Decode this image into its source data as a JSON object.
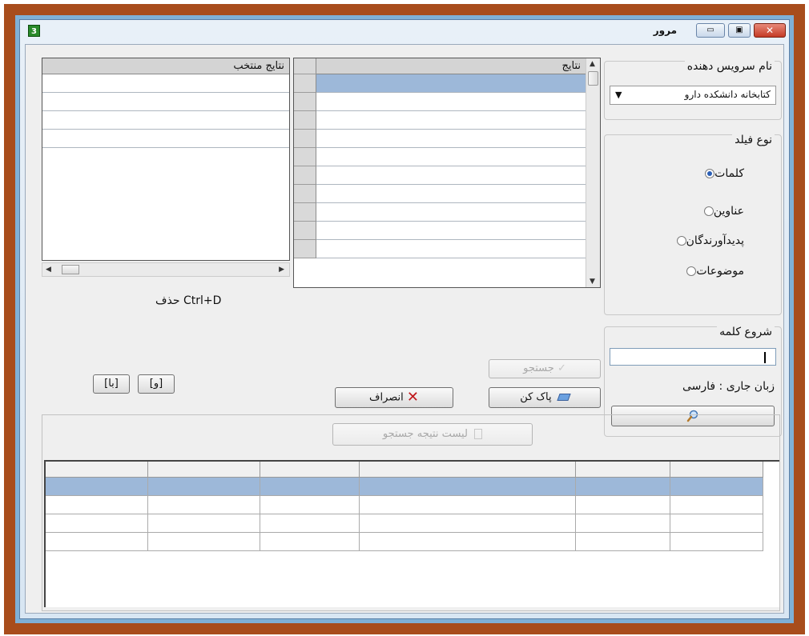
{
  "window": {
    "title": "مرور",
    "app_icon": "3",
    "close_glyph": "✕",
    "max_glyph": "▣",
    "min_glyph": "▭"
  },
  "service": {
    "group_title": "نام سرویس دهنده",
    "selected": "کتابخانه دانشکده دارو",
    "arrow": "▼"
  },
  "field_type": {
    "group_title": "نوع فیلد",
    "options": [
      {
        "label": "کلمات",
        "checked": true
      },
      {
        "label": "عناوین",
        "checked": false
      },
      {
        "label": "پدیدآورندگان",
        "checked": false
      },
      {
        "label": "موضوعات",
        "checked": false
      }
    ]
  },
  "word_start": {
    "group_title": "شروع کلمه",
    "value": "",
    "language_label": "زبان جاری : فارسی",
    "search_icon": "magnifier-icon"
  },
  "results": {
    "header": "نتایج",
    "rows": 10
  },
  "selected_results": {
    "header": "نتایج منتخب",
    "rows": 4,
    "delete_hint": "حذف Ctrl+D",
    "and_button": "[و]",
    "with_button": "[با]"
  },
  "actions": {
    "search_button": "جستجو",
    "clear_button": "پاک کن",
    "cancel_button": "انصراف",
    "result_list_button": "لیست نتیجه جستجو"
  },
  "colors": {
    "frame_outer": "#a84d1c",
    "frame_inner": "#7fb0d6",
    "selection": "#9db8d9"
  }
}
